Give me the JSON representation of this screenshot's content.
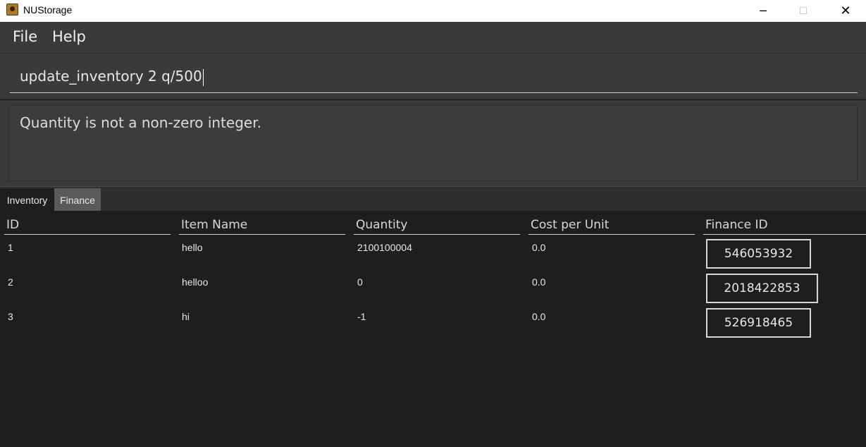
{
  "window": {
    "title": "NUStorage",
    "minimize_glyph": "─",
    "maximize_glyph": "☐",
    "close_glyph": "✕"
  },
  "menu": {
    "items": [
      {
        "label": "File"
      },
      {
        "label": "Help"
      }
    ]
  },
  "command": {
    "value": "update_inventory 2 q/500"
  },
  "result": {
    "message": "Quantity is not a non-zero integer."
  },
  "tabs": [
    {
      "label": "Inventory",
      "selected": true
    },
    {
      "label": "Finance",
      "selected": false
    }
  ],
  "table": {
    "headers": [
      "ID",
      "Item Name",
      "Quantity",
      "Cost per Unit",
      "Finance ID"
    ],
    "rows": [
      {
        "id": "1",
        "name": "hello",
        "quantity": "2100100004",
        "cost": "0.0",
        "finance_id": "546053932"
      },
      {
        "id": "2",
        "name": "helloo",
        "quantity": "0",
        "cost": "0.0",
        "finance_id": "2018422853"
      },
      {
        "id": "3",
        "name": "hi",
        "quantity": "-1",
        "cost": "0.0",
        "finance_id": "526918465"
      }
    ]
  },
  "colors": {
    "background": "#1e1e1e",
    "panel": "#3a3a3a",
    "text": "#e8e8e8"
  }
}
